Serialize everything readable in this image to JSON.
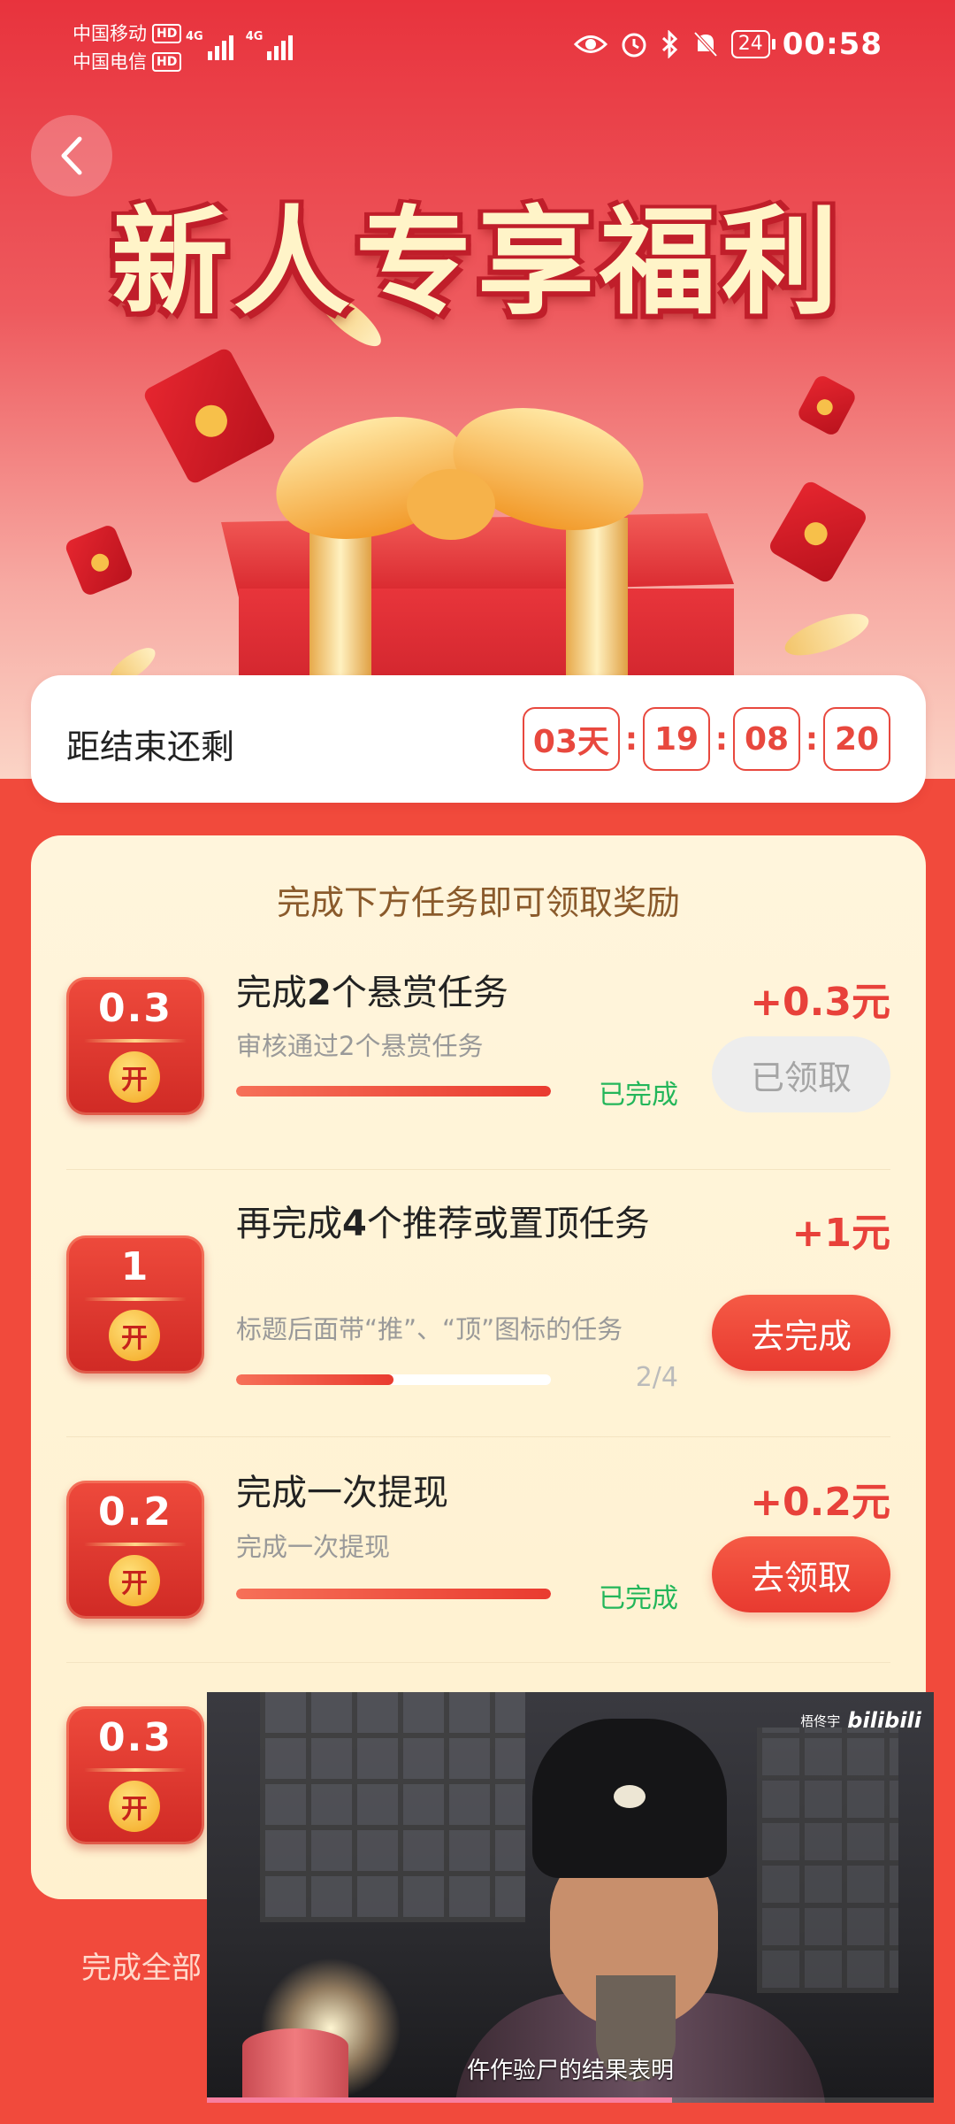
{
  "status_bar": {
    "carrier_1": "中国移动",
    "carrier_2": "中国电信",
    "hd_badge": "HD",
    "network_1": "4G",
    "network_2": "4G",
    "battery": "24",
    "time": "00:58"
  },
  "banner": {
    "title": "新人专享福利"
  },
  "countdown": {
    "label": "距结束还剩",
    "days": "03天",
    "hours": "19",
    "minutes": "08",
    "seconds": "20",
    "separator": ":"
  },
  "tasks": {
    "heading": "完成下方任务即可领取奖励",
    "coin_open_label": "开",
    "done_label": "已完成",
    "items": [
      {
        "coin_value": "0.3",
        "title_prefix": "完成",
        "title_number": "2",
        "title_suffix": "个悬赏任务",
        "desc": "审核通过2个悬赏任务",
        "progress_fraction": 1.0,
        "status": "已完成",
        "reward": "+0.3元",
        "button": "已领取"
      },
      {
        "coin_value": "1",
        "title_prefix": "再完成",
        "title_number": "4",
        "title_suffix": "个推荐或置顶任务",
        "desc": "标题后面带“推”、“顶”图标的任务",
        "progress_fraction": 0.5,
        "status": "2/4",
        "reward": "+1元",
        "button": "去完成"
      },
      {
        "coin_value": "0.2",
        "title_prefix": "完成一次提现",
        "title_number": "",
        "title_suffix": "",
        "desc": "完成一次提现",
        "progress_fraction": 1.0,
        "status": "已完成",
        "reward": "+0.2元",
        "button": "去领取"
      },
      {
        "coin_value": "0.3"
      }
    ]
  },
  "footer": {
    "note": "完成全部"
  },
  "video": {
    "watermark_author": "梧佟宇",
    "watermark_brand": "bilibili",
    "subtitle": "仵作验尸的结果表明",
    "progress_fraction": 0.64
  },
  "colors": {
    "accent": "#e8413a",
    "done_green": "#23b65a",
    "card_bg": "#fff5dc"
  }
}
